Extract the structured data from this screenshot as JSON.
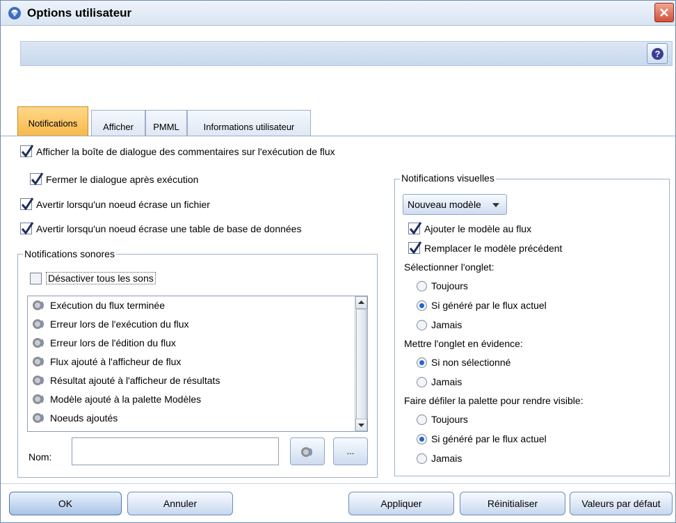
{
  "window": {
    "title": "Options utilisateur"
  },
  "tabs": [
    {
      "label": "Notifications",
      "active": true
    },
    {
      "label": "Afficher",
      "active": false
    },
    {
      "label": "PMML",
      "active": false
    },
    {
      "label": "Informations utilisateur",
      "active": false
    }
  ],
  "options": {
    "show_dialog": {
      "label": "Afficher la boîte de dialogue des commentaires sur l'exécution de flux",
      "checked": true
    },
    "close_dialog": {
      "label": "Fermer le dialogue après exécution",
      "checked": true
    },
    "warn_file": {
      "label": "Avertir lorsqu'un noeud écrase un fichier",
      "checked": true
    },
    "warn_table": {
      "label": "Avertir lorsqu'un noeud écrase une table de base de données",
      "checked": true
    }
  },
  "sound": {
    "group_title": "Notifications sonores",
    "disable_all": {
      "label": "Désactiver tous les sons",
      "checked": false
    },
    "items": [
      "Exécution du flux terminée",
      "Erreur lors de l'exécution du flux",
      "Erreur lors de l'édition du flux",
      "Flux ajouté à l'afficheur de flux",
      "Résultat ajouté à l'afficheur de résultats",
      "Modèle ajouté à la palette Modèles",
      "Noeuds ajoutés"
    ],
    "name_label": "Nom:",
    "name_value": "",
    "browse_label": "..."
  },
  "visual": {
    "group_title": "Notifications visuelles",
    "dropdown_value": "Nouveau modèle",
    "add_model": {
      "label": "Ajouter le modèle au flux",
      "checked": true
    },
    "replace_model": {
      "label": "Remplacer le modèle précédent",
      "checked": true
    },
    "select_tab_label": "Sélectionner l'onglet:",
    "select_tab_options": [
      {
        "label": "Toujours",
        "selected": false
      },
      {
        "label": "Si généré par le flux actuel",
        "selected": true
      },
      {
        "label": "Jamais",
        "selected": false
      }
    ],
    "highlight_label": "Mettre l'onglet en évidence:",
    "highlight_options": [
      {
        "label": "Si non sélectionné",
        "selected": true
      },
      {
        "label": "Jamais",
        "selected": false
      }
    ],
    "scroll_label": "Faire défiler la palette pour rendre visible:",
    "scroll_options": [
      {
        "label": "Toujours",
        "selected": false
      },
      {
        "label": "Si généré par le flux actuel",
        "selected": true
      },
      {
        "label": "Jamais",
        "selected": false
      }
    ]
  },
  "buttons": {
    "ok": "OK",
    "cancel": "Annuler",
    "apply": "Appliquer",
    "reset": "Réinitialiser",
    "defaults": "Valeurs par défaut"
  },
  "colors": {
    "active_tab": "#f7b84a",
    "accent": "#2466c9",
    "close": "#d2503a"
  },
  "icons": {
    "app": "diamond-gem-icon",
    "close": "close-icon",
    "help": "help-icon",
    "sound": "speaker-icon"
  }
}
